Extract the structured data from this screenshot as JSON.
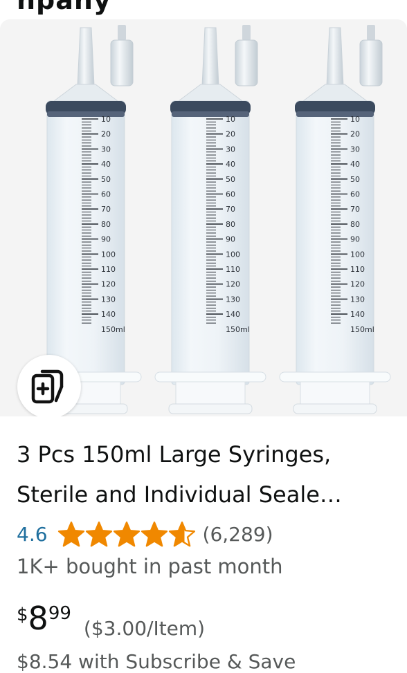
{
  "header": {
    "partial_text": "npany"
  },
  "product": {
    "title_line1": "3 Pcs 150ml Large Syringes,",
    "title_line2": "Sterile and Individual Seale…",
    "rating": "4.6",
    "stars_value": 4.6,
    "stars_max": 5,
    "review_count": "(6,289)",
    "bought": "1K+ bought in past month",
    "price": {
      "symbol": "$",
      "whole": "8",
      "fraction": "99"
    },
    "unit_price": "($3.00/Item)",
    "subscribe_price": "$8.54 with Subscribe & Save"
  },
  "image": {
    "syringe_count": 3,
    "scale_labels": [
      "10",
      "20",
      "30",
      "40",
      "50",
      "60",
      "70",
      "80",
      "90",
      "100",
      "110",
      "120",
      "130",
      "140",
      "150ml"
    ],
    "badge_icon": "add-to-list-icon"
  },
  "colors": {
    "accent_star": "#f08800",
    "rating_link": "#1f6f9e",
    "secondary_text": "#565959",
    "primary_text": "#0f1111",
    "image_bg": "#f4f4f4"
  }
}
